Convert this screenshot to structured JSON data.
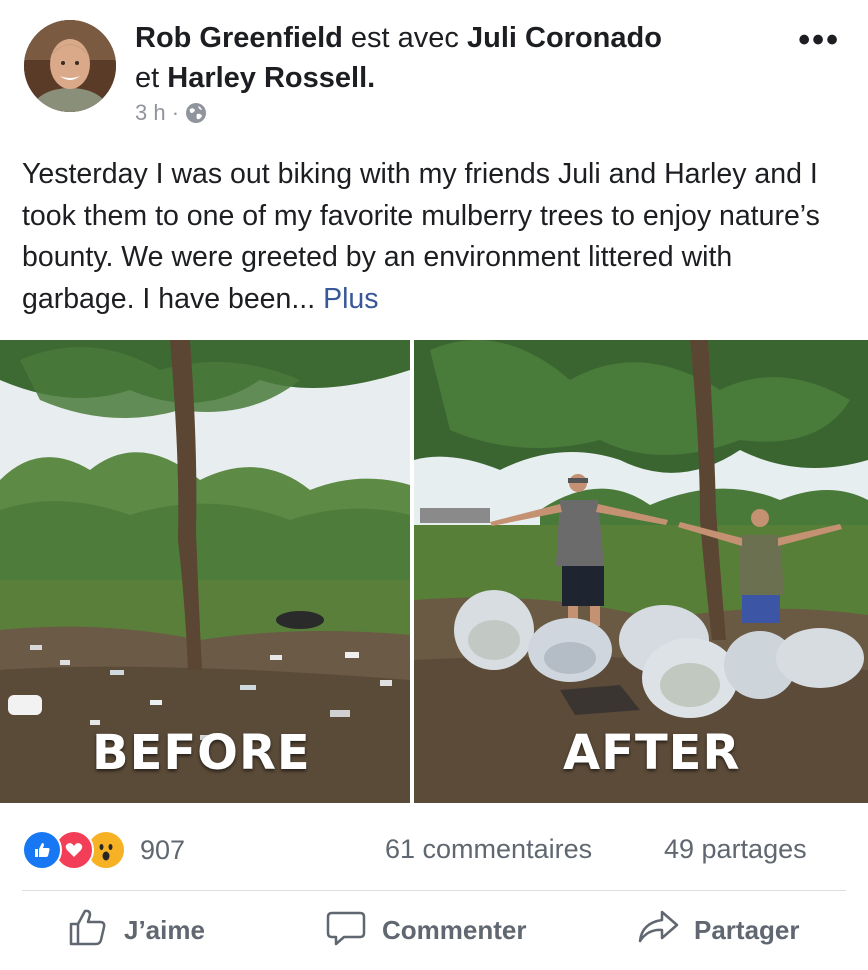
{
  "header": {
    "author": "Rob Greenfield",
    "with_text": "est avec",
    "tagged_1": "Juli Coronado",
    "and_text": "et",
    "tagged_2": "Harley Rossell.",
    "timestamp": "3 h ·",
    "more_label": "•••"
  },
  "post": {
    "text": "Yesterday I was out biking with my friends Juli and Harley and I took them to one of my favorite mulberry trees to enjoy nature’s bounty. We were greeted by an environment littered with garbage. I have been...",
    "see_more": "Plus"
  },
  "photo": {
    "label_before": "BEFORE",
    "label_after": "AFTER"
  },
  "stats": {
    "reaction_count": "907",
    "reaction_icons": [
      "like-icon",
      "love-icon",
      "wow-icon"
    ],
    "comments": "61 commentaires",
    "shares": "49 partages"
  },
  "actions": {
    "like": "J’aime",
    "comment": "Commenter",
    "share": "Partager"
  },
  "colors": {
    "text": "#1c1e21",
    "secondary": "#606770",
    "link": "#385898",
    "like_blue": "#1877f2",
    "love_red": "#f33e58",
    "wow_yellow": "#f7b125"
  }
}
